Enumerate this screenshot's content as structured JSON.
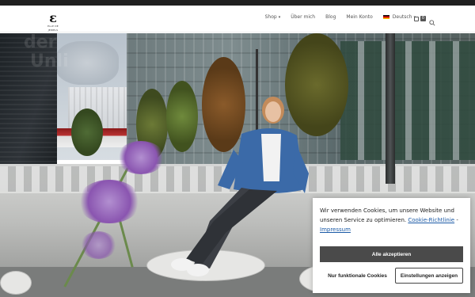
{
  "site": {
    "logo_glyph": "ε",
    "logo_tag": "ELLE DE JEWELS"
  },
  "nav": {
    "items": [
      {
        "label": "Shop",
        "has_dropdown": true
      },
      {
        "label": "Über mich",
        "has_dropdown": false
      },
      {
        "label": "Blog",
        "has_dropdown": false
      },
      {
        "label": "Mein Konto",
        "has_dropdown": false
      },
      {
        "label": "Deutsch",
        "has_dropdown": true,
        "icon": "german-flag-icon"
      }
    ],
    "cart_count": "0",
    "search_icon": "search-icon"
  },
  "hero": {
    "watermark_line1": "der",
    "watermark_line2": "Unli"
  },
  "cookie": {
    "message": "Wir verwenden Cookies, um unsere Website und unseren Service zu optimieren.",
    "link_policy": "Cookie-Richtlinie",
    "separator": "-",
    "link_imprint": "Impressum",
    "accept_all": "Alle akzeptieren",
    "functional_only": "Nur funktionale Cookies",
    "settings": "Einstellungen anzeigen"
  },
  "colors": {
    "accent_dark": "#4a4a4a",
    "link": "#1b5aa6"
  }
}
